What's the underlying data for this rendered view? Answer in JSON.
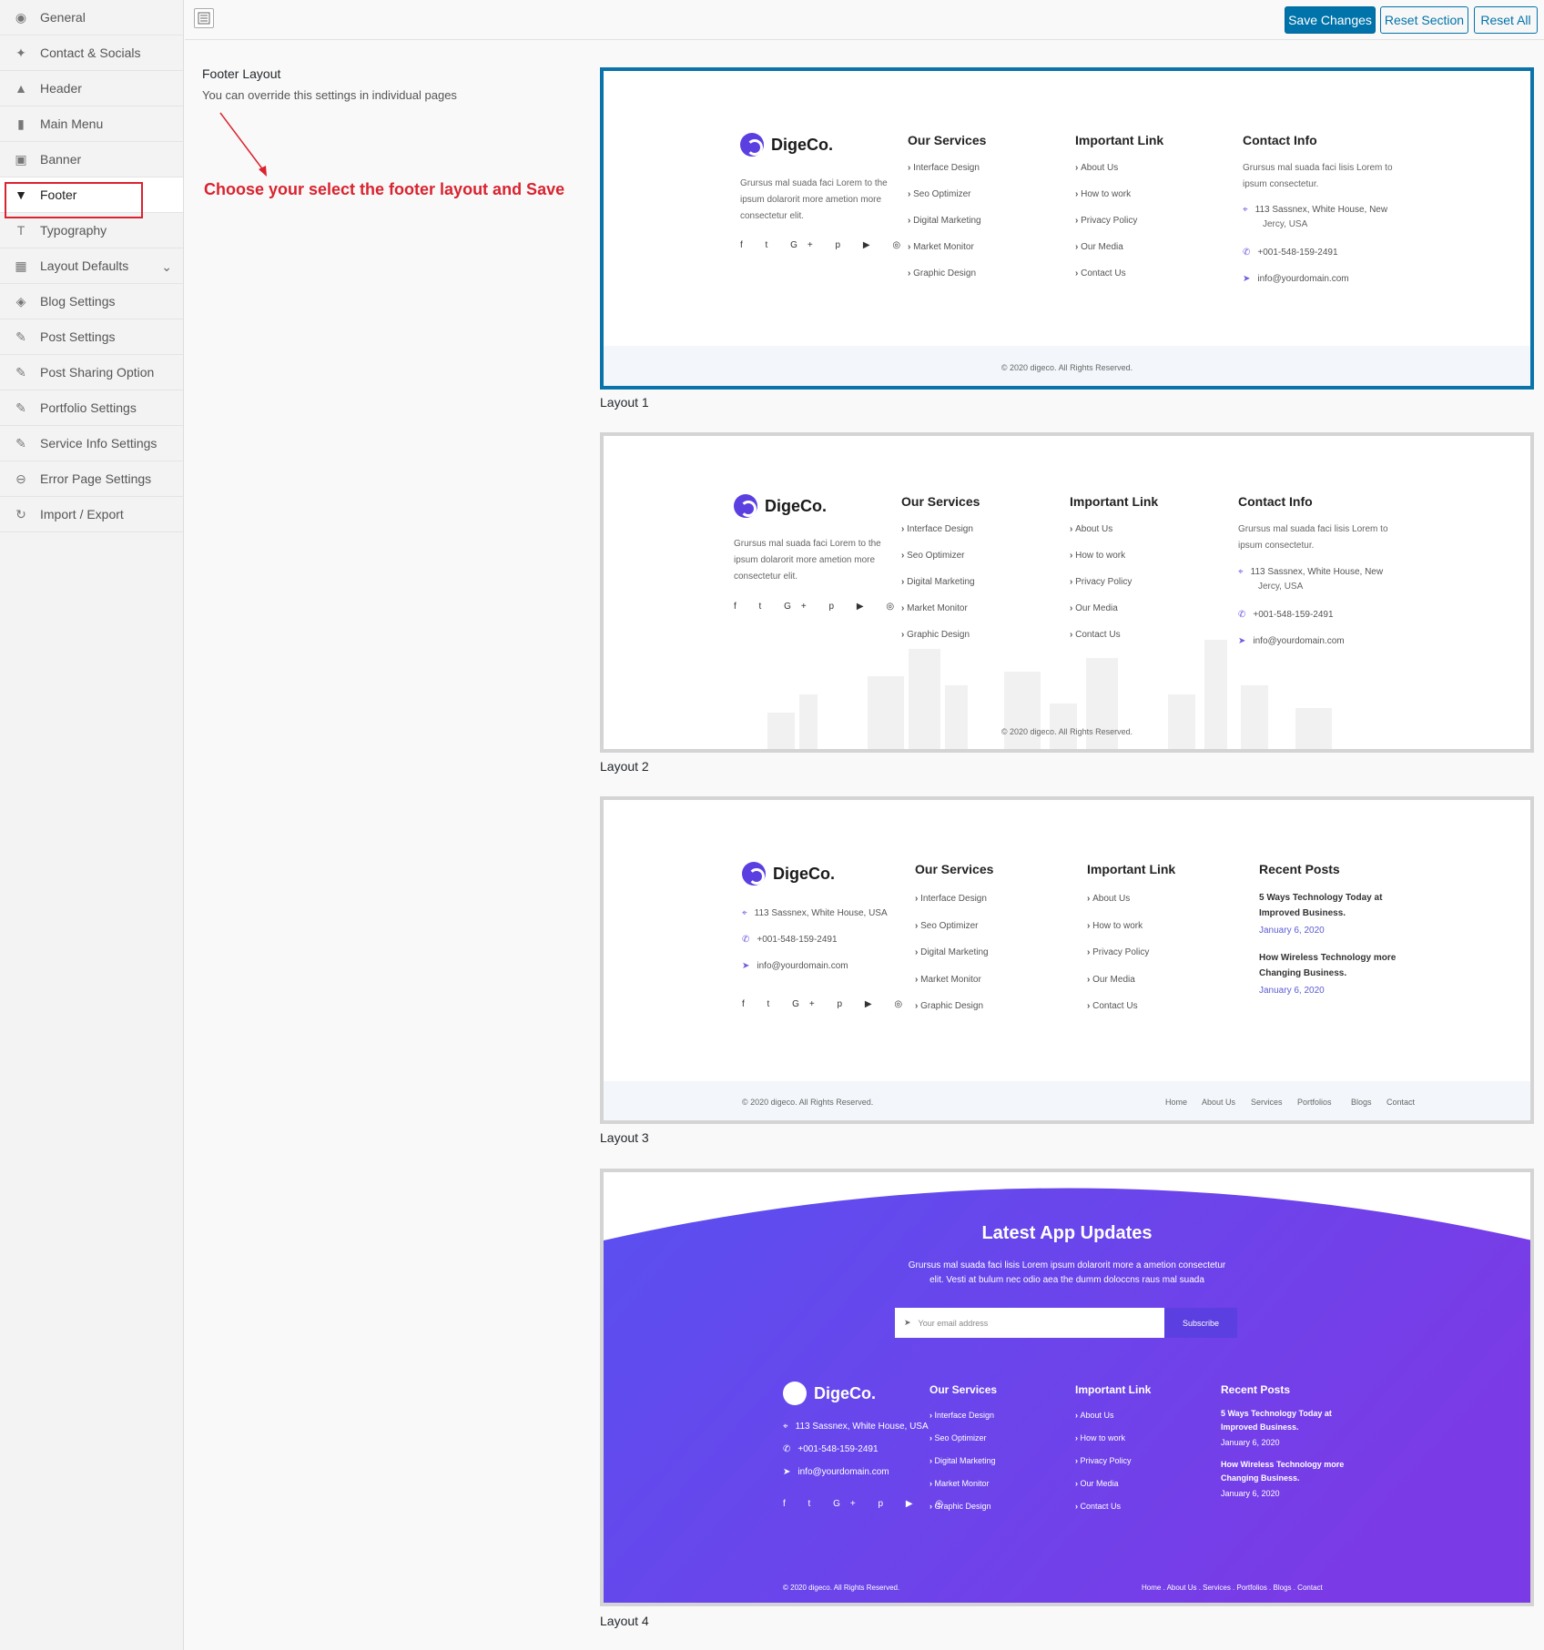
{
  "sidebar": {
    "items": [
      {
        "label": "General",
        "icon": "globe-icon"
      },
      {
        "label": "Contact & Socials",
        "icon": "twitter-icon"
      },
      {
        "label": "Header",
        "icon": "triangle-icon"
      },
      {
        "label": "Main Menu",
        "icon": "book-icon"
      },
      {
        "label": "Banner",
        "icon": "image-icon"
      },
      {
        "label": "Footer",
        "icon": "filter-icon"
      },
      {
        "label": "Typography",
        "icon": "text-icon"
      },
      {
        "label": "Layout Defaults",
        "icon": "grid-icon"
      },
      {
        "label": "Blog Settings",
        "icon": "tags-icon"
      },
      {
        "label": "Post Settings",
        "icon": "edit-icon"
      },
      {
        "label": "Post Sharing Option",
        "icon": "edit-icon"
      },
      {
        "label": "Portfolio Settings",
        "icon": "edit-icon"
      },
      {
        "label": "Service Info Settings",
        "icon": "edit-icon"
      },
      {
        "label": "Error Page Settings",
        "icon": "minus-circle-icon"
      },
      {
        "label": "Import / Export",
        "icon": "refresh-icon"
      }
    ]
  },
  "toolbar": {
    "save_label": "Save Changes",
    "reset_section_label": "Reset Section",
    "reset_all_label": "Reset All"
  },
  "main": {
    "title": "Footer Layout",
    "description": "You can override this settings in individual pages",
    "annotation": "Choose your select the footer layout and Save"
  },
  "brand": "DigeCo.",
  "services": {
    "heading": "Our Services",
    "items": [
      "Interface Design",
      "Seo Optimizer",
      "Digital Marketing",
      "Market Monitor",
      "Graphic Design"
    ]
  },
  "links": {
    "heading": "Important Link",
    "items": [
      "About Us",
      "How to work",
      "Privacy Policy",
      "Our Media",
      "Contact Us"
    ]
  },
  "contact": {
    "heading": "Contact Info",
    "intro_1": "Grursus mal suada faci lisis Lorem to",
    "intro_2": "ipsum consectetur.",
    "address_1": "113 Sassnex, White House, New",
    "address_2": "Jercy, USA",
    "address_short": "113 Sassnex, White House, USA",
    "phone": "+001-548-159-2491",
    "email": "info@yourdomain.com"
  },
  "about_text": {
    "line1": "Grursus mal suada faci Lorem to the",
    "line2": "ipsum dolarorit more ametion more",
    "line3": "consectetur elit."
  },
  "social": "f  t  G+  p  ▶  ◎",
  "copyright": "© 2020 digeco. All Rights Reserved.",
  "recent": {
    "heading": "Recent Posts",
    "p1_line1": "5 Ways Technology Today at",
    "p1_line2": "Improved Business.",
    "p1_date": "January 6, 2020",
    "p2_line1": "How Wireless Technology more",
    "p2_line2": "Changing Business.",
    "p2_date": "January 6, 2020"
  },
  "bottom_nav": [
    "Home",
    "About Us",
    "Services",
    "Portfolios",
    "Blogs",
    "Contact"
  ],
  "bottom_nav_dotted": "Home  .  About Us  .  Services  .  Portfolios  .  Blogs  .  Contact",
  "app_updates": {
    "title": "Latest App Updates",
    "text_1": "Grursus mal suada faci lisis Lorem ipsum dolarorit more a ametion consectetur",
    "text_2": "elit. Vesti at bulum nec odio aea the dumm doloccns raus mal suada",
    "email_placeholder": "Your email address",
    "subscribe": "Subscribe"
  },
  "layouts": [
    "Layout 1",
    "Layout 2",
    "Layout 3",
    "Layout 4"
  ],
  "colors": {
    "accent": "#0073aa",
    "annotation": "#d9232f",
    "brand": "#5b3fe0",
    "gradient_start": "#5a4ff0",
    "gradient_end": "#7a3be6"
  }
}
